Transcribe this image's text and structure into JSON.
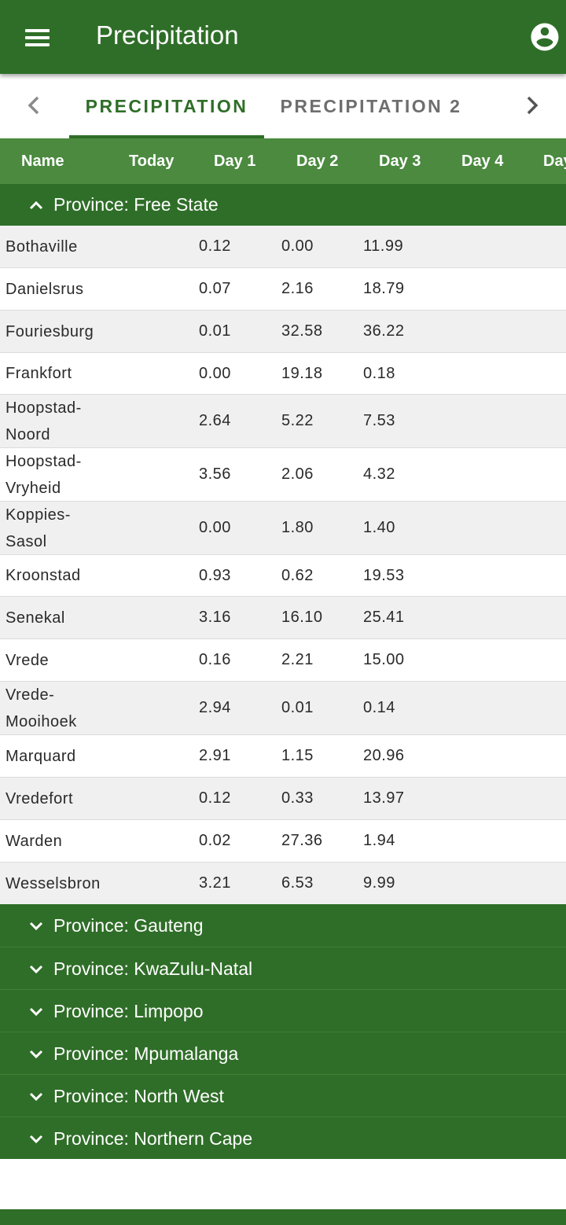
{
  "app": {
    "title": "Precipitation",
    "menu_icon": "menu-icon",
    "account_icon": "account-circle-icon",
    "brand_color": "#2f6e28"
  },
  "tabs": [
    {
      "label": "PRECIPITATION",
      "active": true
    },
    {
      "label": "PRECIPITATION 2",
      "active": false
    }
  ],
  "table": {
    "columns": [
      "Name",
      "Today",
      "Day 1",
      "Day 2",
      "Day 3",
      "Day 4",
      "Day"
    ],
    "expanded_group": {
      "label": "Province: Free State",
      "rows": [
        {
          "name": "Bothaville",
          "v1": "0.12",
          "v2": "0.00",
          "v3": "11.99"
        },
        {
          "name": "Danielsrus",
          "v1": "0.07",
          "v2": "2.16",
          "v3": "18.79"
        },
        {
          "name": "Fouriesburg",
          "v1": "0.01",
          "v2": "32.58",
          "v3": "36.22"
        },
        {
          "name": "Frankfort",
          "v1": "0.00",
          "v2": "19.18",
          "v3": "0.18"
        },
        {
          "name": "Hoopstad-Noord",
          "v1": "2.64",
          "v2": "5.22",
          "v3": "7.53"
        },
        {
          "name": "Hoopstad-Vryheid",
          "v1": "3.56",
          "v2": "2.06",
          "v3": "4.32"
        },
        {
          "name": "Koppies-Sasol",
          "v1": "0.00",
          "v2": "1.80",
          "v3": "1.40"
        },
        {
          "name": "Kroonstad",
          "v1": "0.93",
          "v2": "0.62",
          "v3": "19.53"
        },
        {
          "name": "Senekal",
          "v1": "3.16",
          "v2": "16.10",
          "v3": "25.41"
        },
        {
          "name": "Vrede",
          "v1": "0.16",
          "v2": "2.21",
          "v3": "15.00"
        },
        {
          "name": "Vrede-Mooihoek",
          "v1": "2.94",
          "v2": "0.01",
          "v3": "0.14"
        },
        {
          "name": "Marquard",
          "v1": "2.91",
          "v2": "1.15",
          "v3": "20.96"
        },
        {
          "name": "Vredefort",
          "v1": "0.12",
          "v2": "0.33",
          "v3": "13.97"
        },
        {
          "name": "Warden",
          "v1": "0.02",
          "v2": "27.36",
          "v3": "1.94"
        },
        {
          "name": "Wesselsbron",
          "v1": "3.21",
          "v2": "6.53",
          "v3": "9.99"
        }
      ]
    },
    "collapsed_groups": [
      "Province: Gauteng",
      "Province: KwaZulu-Natal",
      "Province: Limpopo",
      "Province: Mpumalanga",
      "Province: North West",
      "Province: Northern Cape"
    ]
  }
}
